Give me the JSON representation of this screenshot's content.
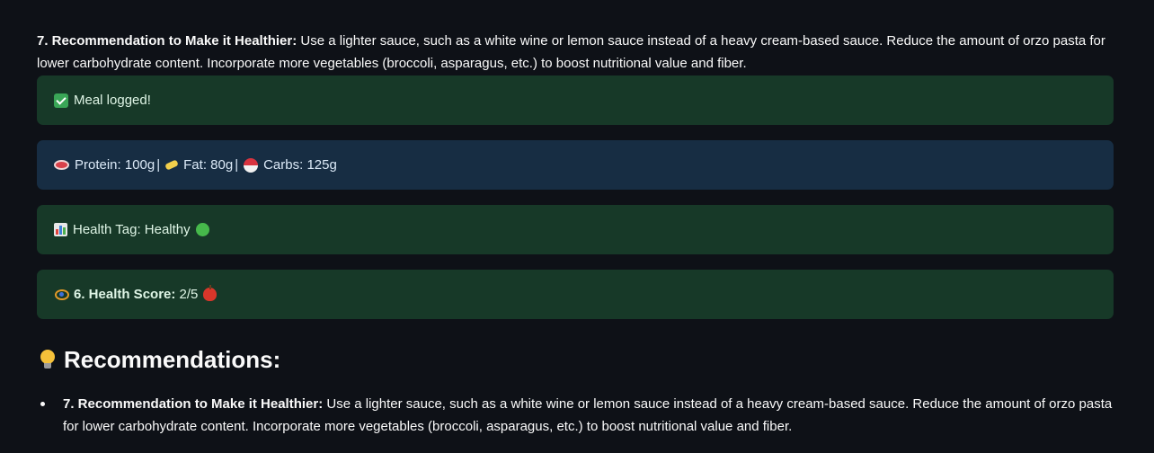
{
  "recommendation": {
    "label": "7. Recommendation to Make it Healthier:",
    "text": " Use a lighter sauce, such as a white wine or lemon sauce instead of a heavy cream-based sauce. Reduce the amount of orzo pasta for lower carbohydrate content. Incorporate more vegetables (broccoli, asparagus, etc.) to boost nutritional value and fiber."
  },
  "alerts": {
    "logged": {
      "icon": "check-mark-icon",
      "text": "Meal logged!",
      "color": "#173928"
    },
    "macros": {
      "color": "#172d43",
      "protein": {
        "icon": "meat-icon",
        "text": "Protein: 100g"
      },
      "fat": {
        "icon": "butter-icon",
        "text": "Fat: 80g"
      },
      "carbs": {
        "icon": "rice-icon",
        "text": "Carbs: 125g"
      },
      "separator": "|"
    },
    "tag": {
      "icon": "bar-chart-icon",
      "text": "Health Tag: Healthy",
      "status_icon": "green-circle-icon"
    },
    "score": {
      "icon": "eye-icon",
      "label": "6. Health Score:",
      "value": "2/5",
      "status_icon": "apple-icon"
    }
  },
  "recommendations_section": {
    "icon": "light-bulb-icon",
    "title": "Recommendations:",
    "items": [
      {
        "label": "7. Recommendation to Make it Healthier:",
        "text": " Use a lighter sauce, such as a white wine or lemon sauce instead of a heavy cream-based sauce. Reduce the amount of orzo pasta for lower carbohydrate content. Incorporate more vegetables (broccoli, asparagus, etc.) to boost nutritional value and fiber."
      }
    ]
  },
  "colors": {
    "background": "#0e1117",
    "success": "#173928",
    "info": "#172d43"
  }
}
